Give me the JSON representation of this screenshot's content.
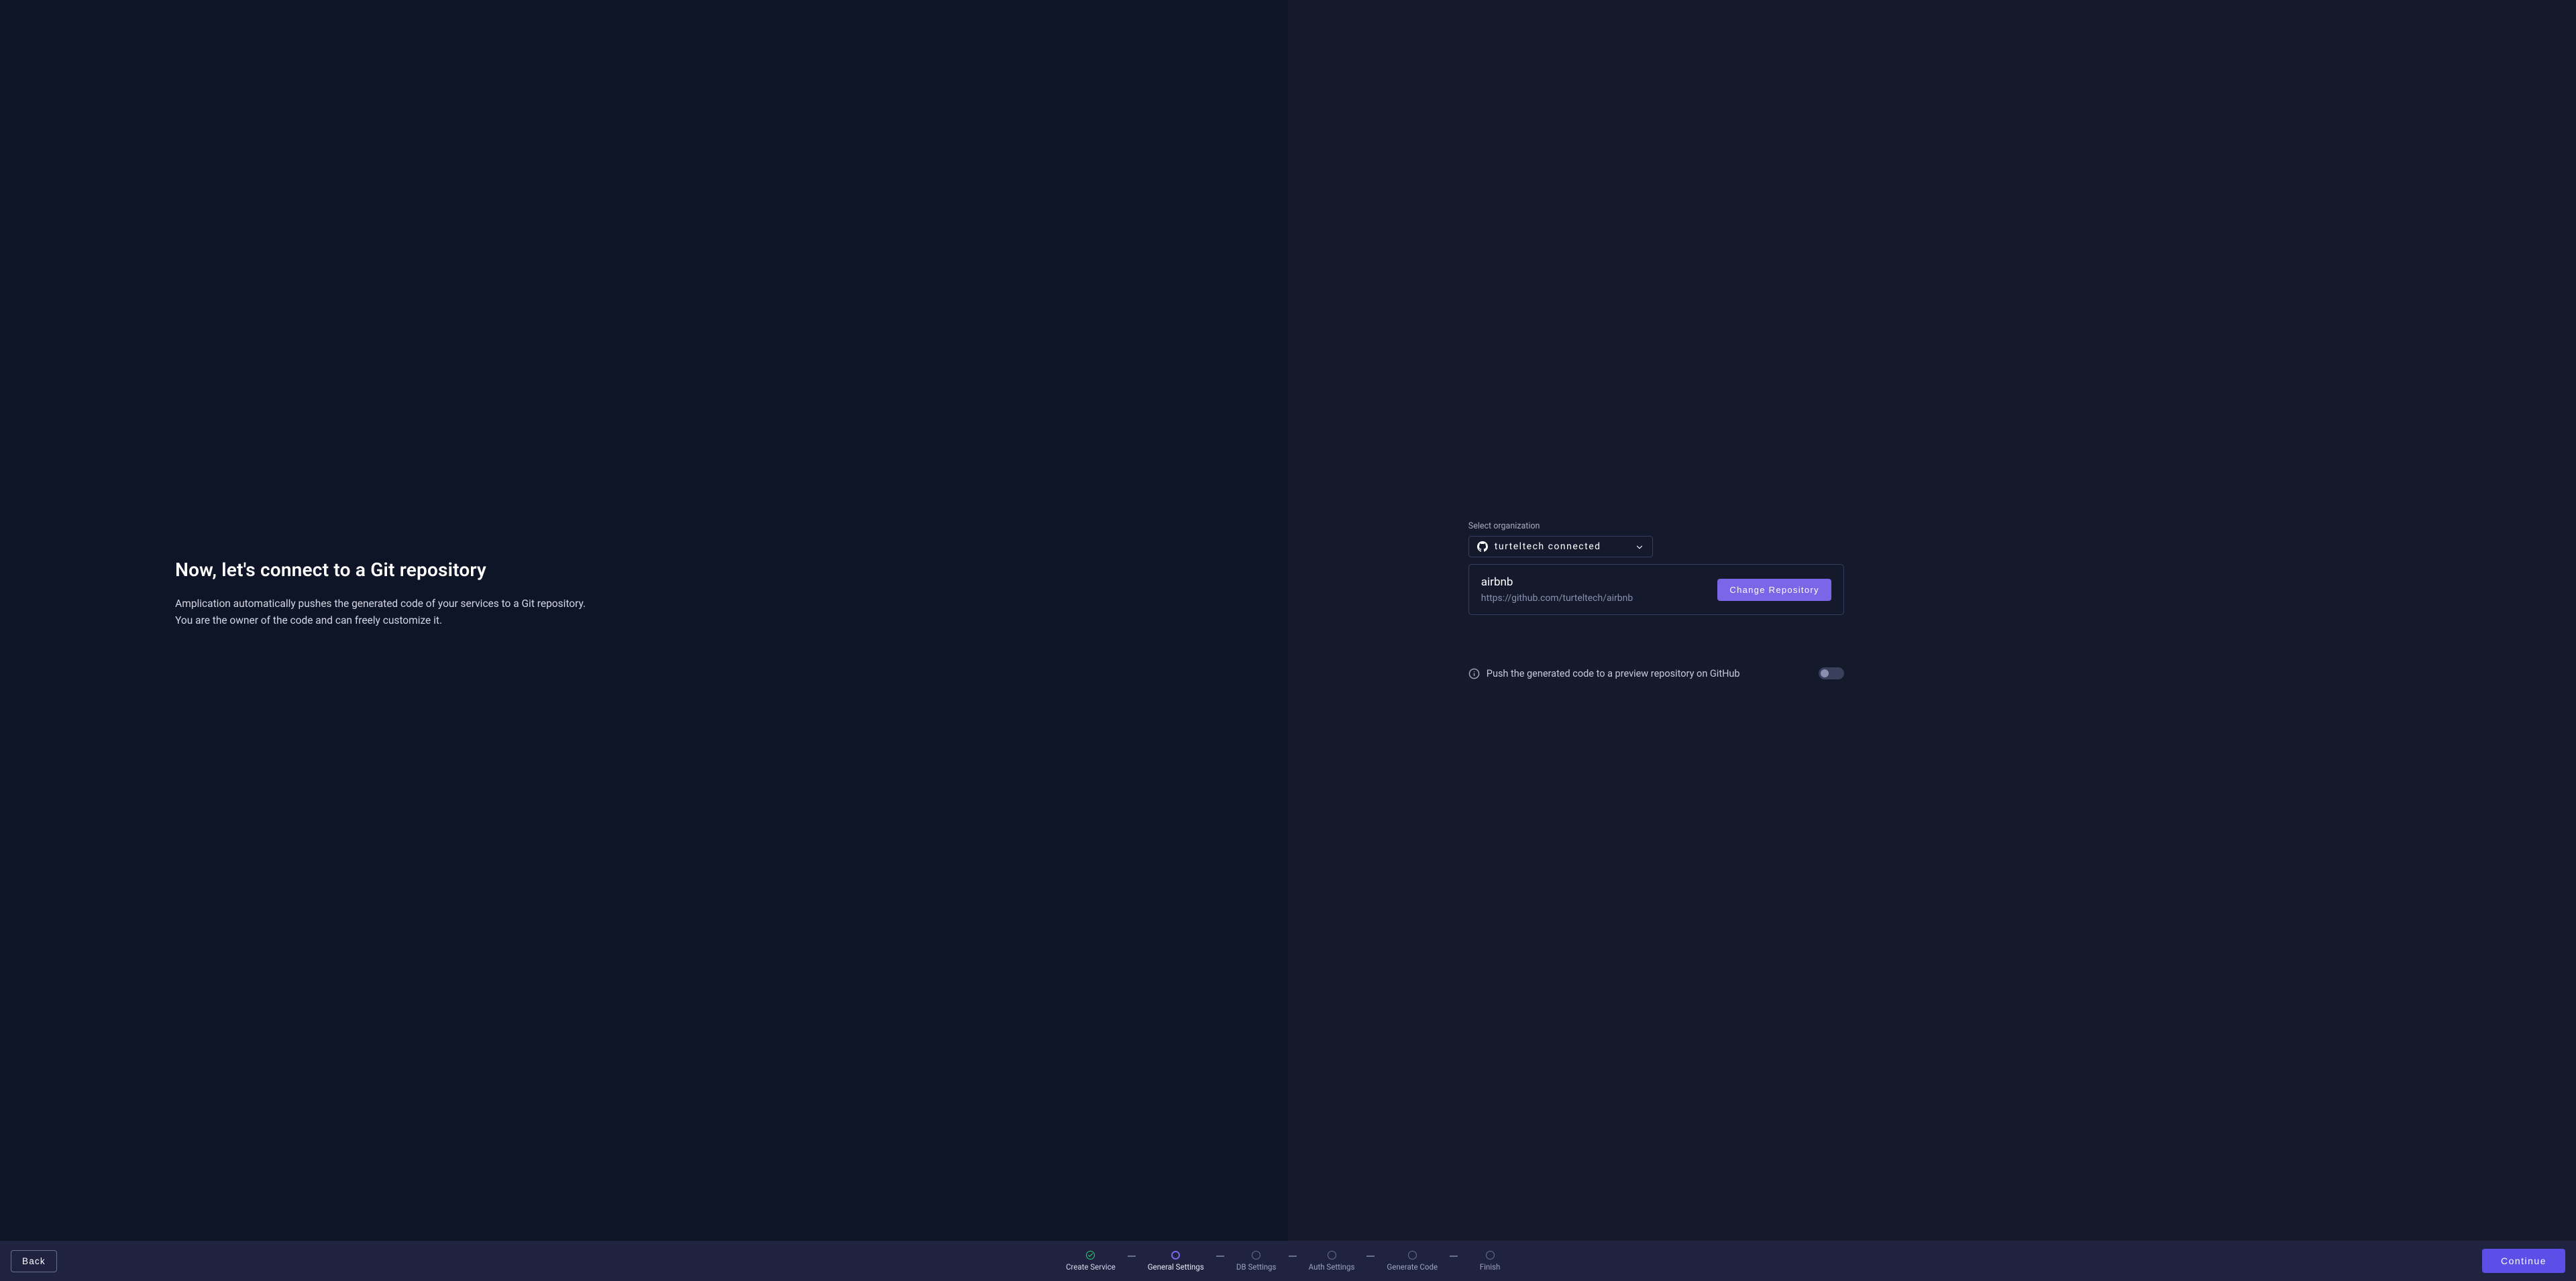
{
  "left": {
    "title": "Now, let's connect to a Git repository",
    "line1": "Amplication automatically pushes the generated code of your services to a Git repository.",
    "line2": "You are the owner of the code and can freely customize it."
  },
  "right": {
    "select_label": "Select organization",
    "org_name": "turteltech connected",
    "repo": {
      "name": "airbnb",
      "url": "https://github.com/turteltech/airbnb",
      "change_label": "Change Repository"
    },
    "push_preview": {
      "text": "Push the generated code to a preview repository on GitHub",
      "enabled": false
    }
  },
  "footer": {
    "back": "Back",
    "continue": "Continue",
    "steps": [
      {
        "label": "Create Service",
        "state": "done"
      },
      {
        "label": "General Settings",
        "state": "current"
      },
      {
        "label": "DB Settings",
        "state": "pending"
      },
      {
        "label": "Auth Settings",
        "state": "pending"
      },
      {
        "label": "Generate Code",
        "state": "pending"
      },
      {
        "label": "Finish",
        "state": "pending"
      }
    ]
  }
}
